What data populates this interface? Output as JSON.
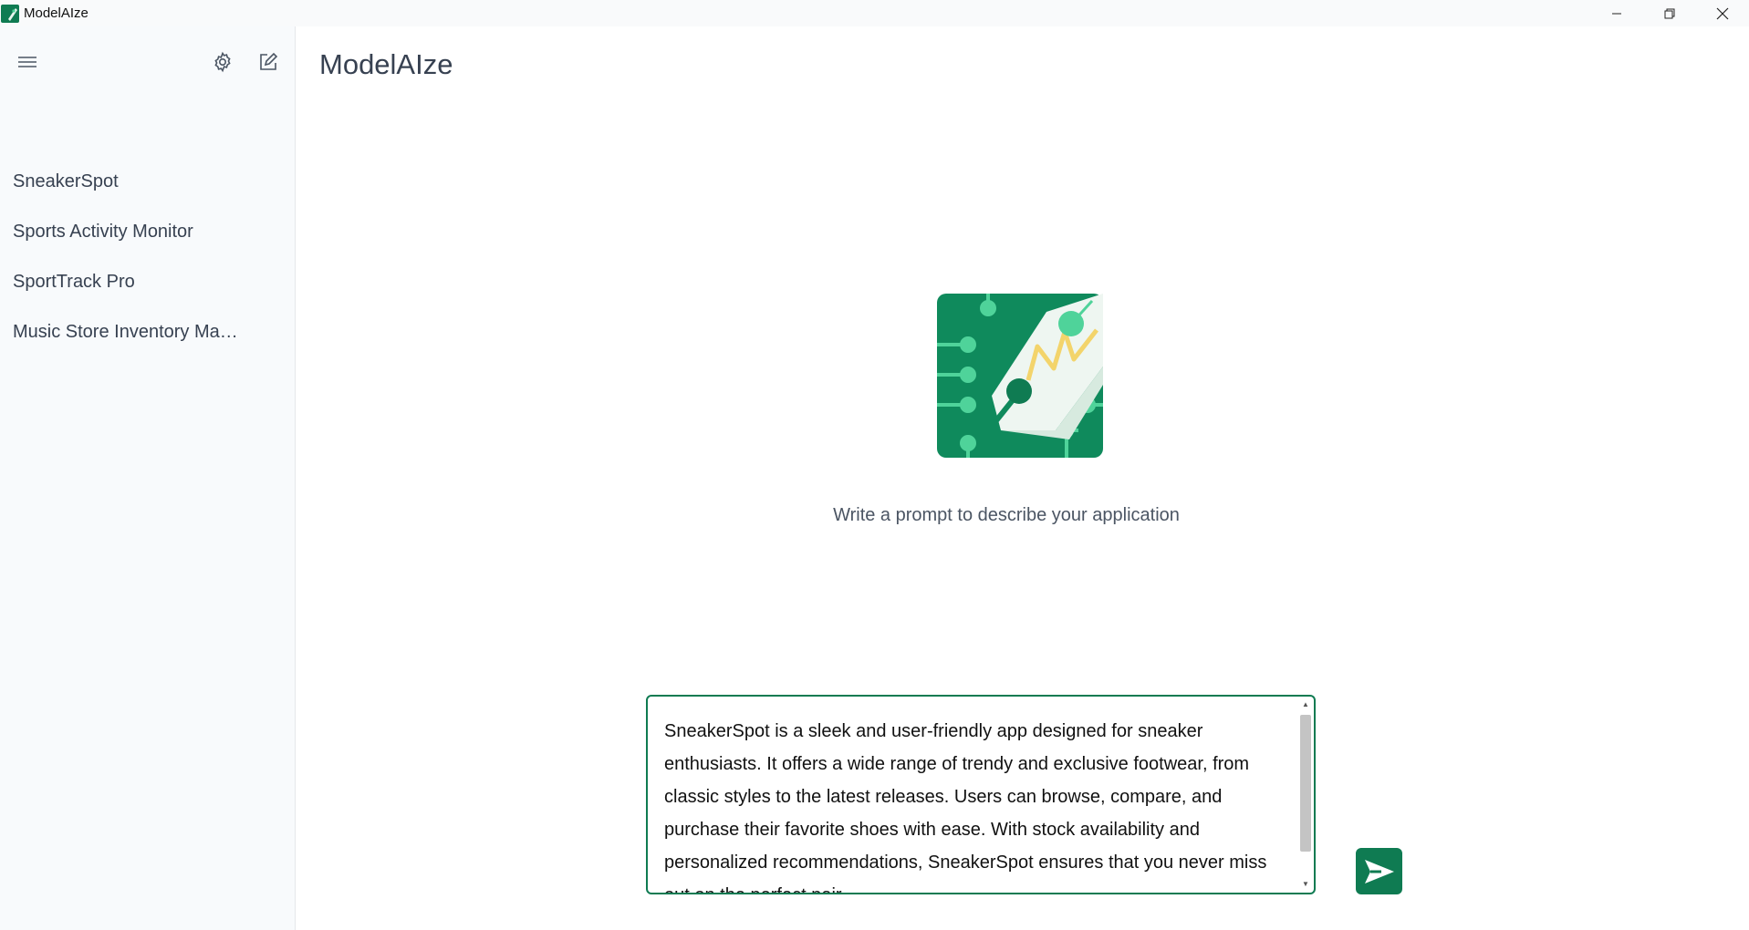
{
  "window": {
    "title": "ModelAIze"
  },
  "sidebar": {
    "items": [
      {
        "label": "SneakerSpot"
      },
      {
        "label": "Sports Activity Monitor"
      },
      {
        "label": "SportTrack Pro"
      },
      {
        "label": "Music Store Inventory Management"
      }
    ]
  },
  "main": {
    "title": "ModelAIze",
    "hint": "Write a prompt to describe your application",
    "prompt_value": "SneakerSpot is a sleek and user-friendly app designed for sneaker enthusiasts. It offers a wide range of trendy and exclusive footwear, from classic styles to the latest releases. Users can browse, compare, and purchase their favorite shoes with ease. With stock availability and personalized recommendations, SneakerSpot ensures that you never miss out on the perfect pair."
  },
  "colors": {
    "accent": "#0f7b52",
    "logo_light": "#4fd39a",
    "spark": "#f3d46b"
  }
}
